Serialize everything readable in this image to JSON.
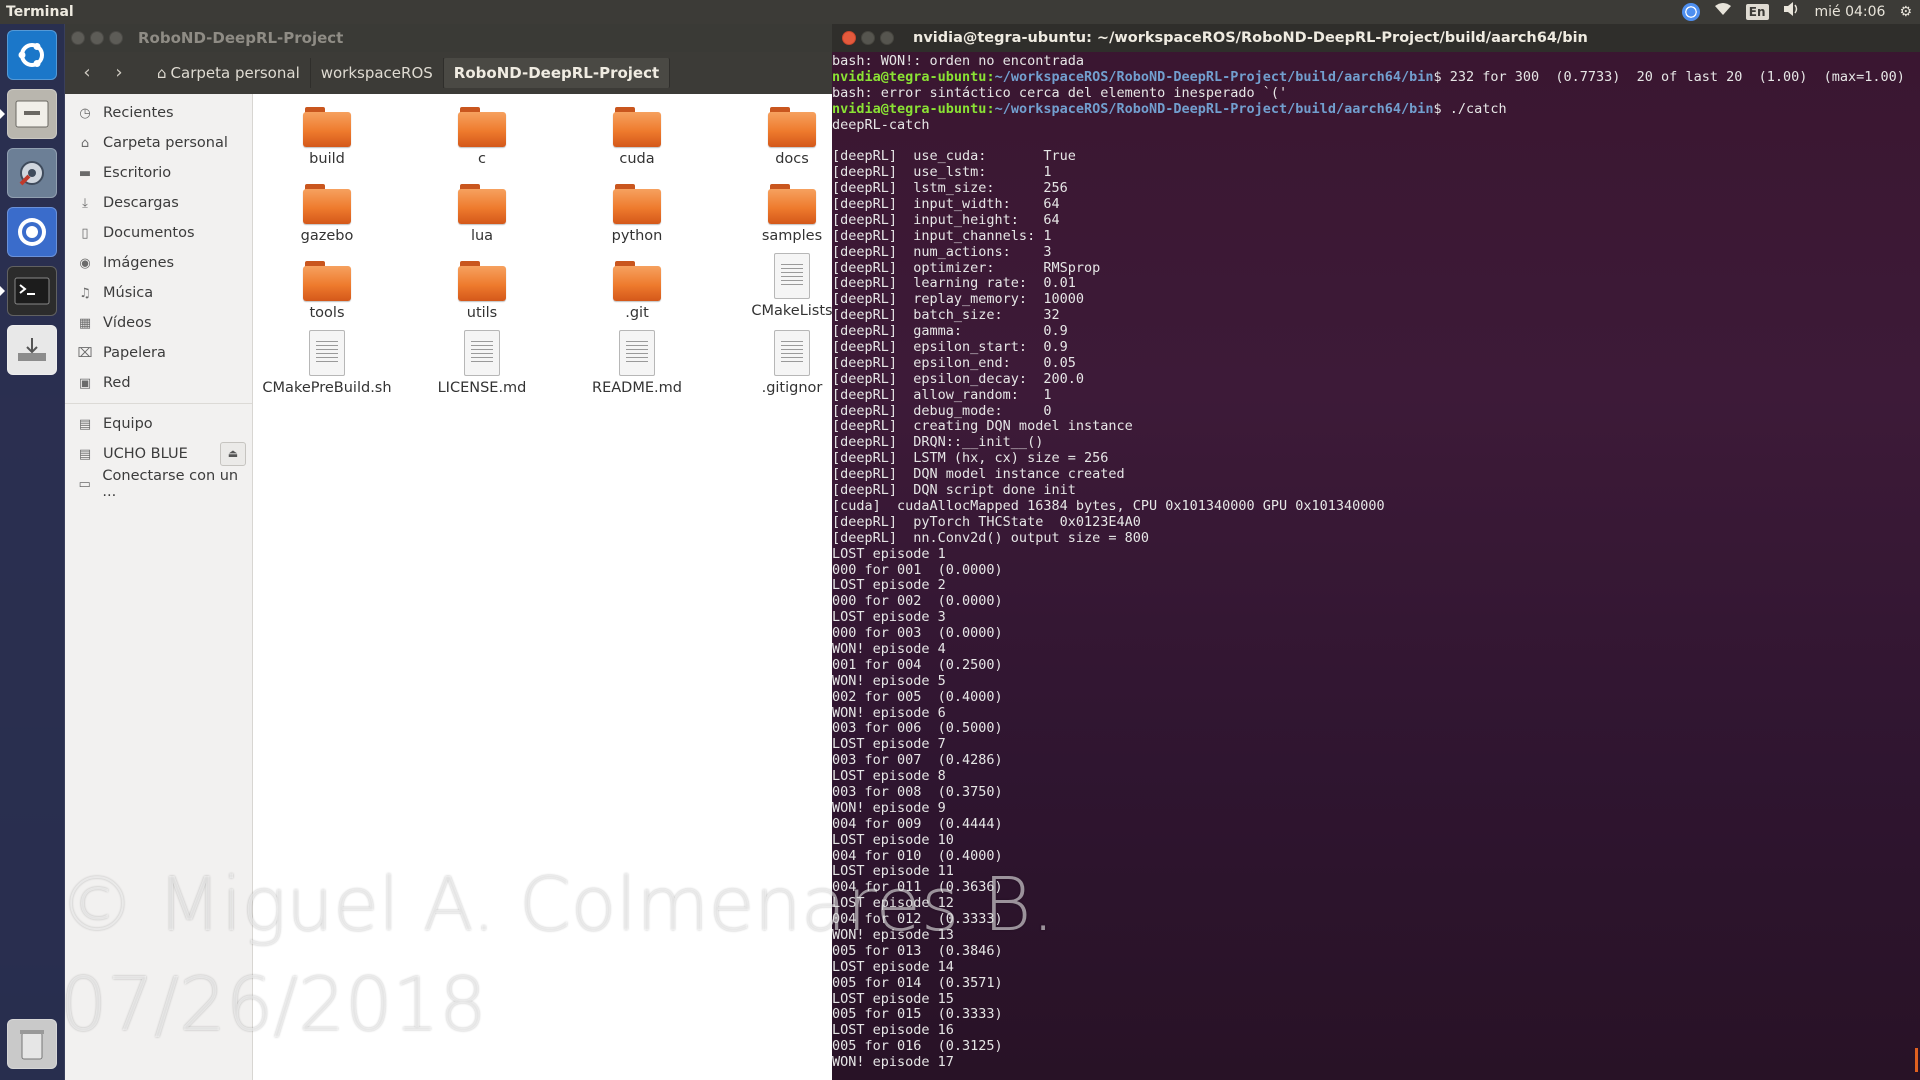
{
  "top_panel": {
    "app_name": "Terminal",
    "keyboard_layout": "En",
    "clock": "mié 04:06"
  },
  "launcher": {
    "items": [
      "ubuntu-dash",
      "files",
      "system-settings",
      "chromium",
      "terminal",
      "installer",
      "trash"
    ]
  },
  "file_manager": {
    "window_title": "RoboND-DeepRL-Project",
    "breadcrumbs": [
      "Carpeta personal",
      "workspaceROS",
      "RoboND-DeepRL-Project"
    ],
    "sidebar": [
      {
        "label": "Recientes",
        "icon": "clock-icon"
      },
      {
        "label": "Carpeta personal",
        "icon": "home-icon"
      },
      {
        "label": "Escritorio",
        "icon": "desktop-icon"
      },
      {
        "label": "Descargas",
        "icon": "download-icon"
      },
      {
        "label": "Documentos",
        "icon": "document-icon"
      },
      {
        "label": "Imágenes",
        "icon": "camera-icon"
      },
      {
        "label": "Música",
        "icon": "music-icon"
      },
      {
        "label": "Vídeos",
        "icon": "video-icon"
      },
      {
        "label": "Papelera",
        "icon": "trash-icon"
      },
      {
        "label": "Red",
        "icon": "network-icon"
      }
    ],
    "devices": [
      {
        "label": "Equipo",
        "icon": "drive-icon"
      },
      {
        "label": "UCHO BLUE",
        "icon": "drive-icon"
      },
      {
        "label": "Conectarse con un ...",
        "icon": "server-icon"
      }
    ],
    "files": [
      {
        "name": "build",
        "type": "folder"
      },
      {
        "name": "c",
        "type": "folder"
      },
      {
        "name": "cuda",
        "type": "folder"
      },
      {
        "name": "docs",
        "type": "folder"
      },
      {
        "name": "gazebo",
        "type": "folder"
      },
      {
        "name": "lua",
        "type": "folder"
      },
      {
        "name": "python",
        "type": "folder"
      },
      {
        "name": "samples",
        "type": "folder"
      },
      {
        "name": "tools",
        "type": "folder"
      },
      {
        "name": "utils",
        "type": "folder"
      },
      {
        "name": ".git",
        "type": "folder"
      },
      {
        "name": "CMakeLists",
        "type": "file"
      },
      {
        "name": "CMakePreBuild.sh",
        "type": "file"
      },
      {
        "name": "LICENSE.md",
        "type": "file"
      },
      {
        "name": "README.md",
        "type": "file"
      },
      {
        "name": ".gitignor",
        "type": "file"
      }
    ]
  },
  "terminal": {
    "window_title": "nvidia@tegra-ubuntu: ~/workspaceROS/RoboND-DeepRL-Project/build/aarch64/bin",
    "prompt_user": "nvidia@tegra-ubuntu",
    "prompt_path": "~/workspaceROS/RoboND-DeepRL-Project/build/aarch64/bin",
    "lines": [
      {
        "text": "bash: WON!: orden no encontrada"
      },
      {
        "prompt": true,
        "text": "$ 232 for 300  (0.7733)  20 of last 20  (1.00)  (max=1.00)"
      },
      {
        "text": "bash: error sintáctico cerca del elemento inesperado `('"
      },
      {
        "prompt": true,
        "text": "$ ./catch"
      },
      {
        "text": "deepRL-catch"
      },
      {
        "text": ""
      },
      {
        "text": "[deepRL]  use_cuda:       True"
      },
      {
        "text": "[deepRL]  use_lstm:       1"
      },
      {
        "text": "[deepRL]  lstm_size:      256"
      },
      {
        "text": "[deepRL]  input_width:    64"
      },
      {
        "text": "[deepRL]  input_height:   64"
      },
      {
        "text": "[deepRL]  input_channels: 1"
      },
      {
        "text": "[deepRL]  num_actions:    3"
      },
      {
        "text": "[deepRL]  optimizer:      RMSprop"
      },
      {
        "text": "[deepRL]  learning rate:  0.01"
      },
      {
        "text": "[deepRL]  replay_memory:  10000"
      },
      {
        "text": "[deepRL]  batch_size:     32"
      },
      {
        "text": "[deepRL]  gamma:          0.9"
      },
      {
        "text": "[deepRL]  epsilon_start:  0.9"
      },
      {
        "text": "[deepRL]  epsilon_end:    0.05"
      },
      {
        "text": "[deepRL]  epsilon_decay:  200.0"
      },
      {
        "text": "[deepRL]  allow_random:   1"
      },
      {
        "text": "[deepRL]  debug_mode:     0"
      },
      {
        "text": "[deepRL]  creating DQN model instance"
      },
      {
        "text": "[deepRL]  DRQN::__init__()"
      },
      {
        "text": "[deepRL]  LSTM (hx, cx) size = 256"
      },
      {
        "text": "[deepRL]  DQN model instance created"
      },
      {
        "text": "[deepRL]  DQN script done init"
      },
      {
        "text": "[cuda]  cudaAllocMapped 16384 bytes, CPU 0x101340000 GPU 0x101340000"
      },
      {
        "text": "[deepRL]  pyTorch THCState  0x0123E4A0"
      },
      {
        "text": "[deepRL]  nn.Conv2d() output size = 800"
      },
      {
        "text": "LOST episode 1"
      },
      {
        "text": "000 for 001  (0.0000)"
      },
      {
        "text": "LOST episode 2"
      },
      {
        "text": "000 for 002  (0.0000)"
      },
      {
        "text": "LOST episode 3"
      },
      {
        "text": "000 for 003  (0.0000)"
      },
      {
        "text": "WON! episode 4"
      },
      {
        "text": "001 for 004  (0.2500)"
      },
      {
        "text": "WON! episode 5"
      },
      {
        "text": "002 for 005  (0.4000)"
      },
      {
        "text": "WON! episode 6"
      },
      {
        "text": "003 for 006  (0.5000)"
      },
      {
        "text": "LOST episode 7"
      },
      {
        "text": "003 for 007  (0.4286)"
      },
      {
        "text": "LOST episode 8"
      },
      {
        "text": "003 for 008  (0.3750)"
      },
      {
        "text": "WON! episode 9"
      },
      {
        "text": "004 for 009  (0.4444)"
      },
      {
        "text": "LOST episode 10"
      },
      {
        "text": "004 for 010  (0.4000)"
      },
      {
        "text": "LOST episode 11"
      },
      {
        "text": "004 for 011  (0.3636)"
      },
      {
        "text": "LOST episode 12"
      },
      {
        "text": "004 for 012  (0.3333)"
      },
      {
        "text": "WON! episode 13"
      },
      {
        "text": "005 for 013  (0.3846)"
      },
      {
        "text": "LOST episode 14"
      },
      {
        "text": "005 for 014  (0.3571)"
      },
      {
        "text": "LOST episode 15"
      },
      {
        "text": "005 for 015  (0.3333)"
      },
      {
        "text": "LOST episode 16"
      },
      {
        "text": "005 for 016  (0.3125)"
      },
      {
        "text": "WON! episode 17"
      }
    ]
  },
  "watermark": {
    "line1": "© Miguel A. Colmenares B.",
    "line2": "07/26/2018"
  },
  "colors": {
    "top_panel_bg": "#3c3b37",
    "terminal_bg": "#3a1630",
    "prompt_user": "#8ae234",
    "prompt_path": "#729fcf",
    "folder_orange": "#ee7a2d"
  }
}
